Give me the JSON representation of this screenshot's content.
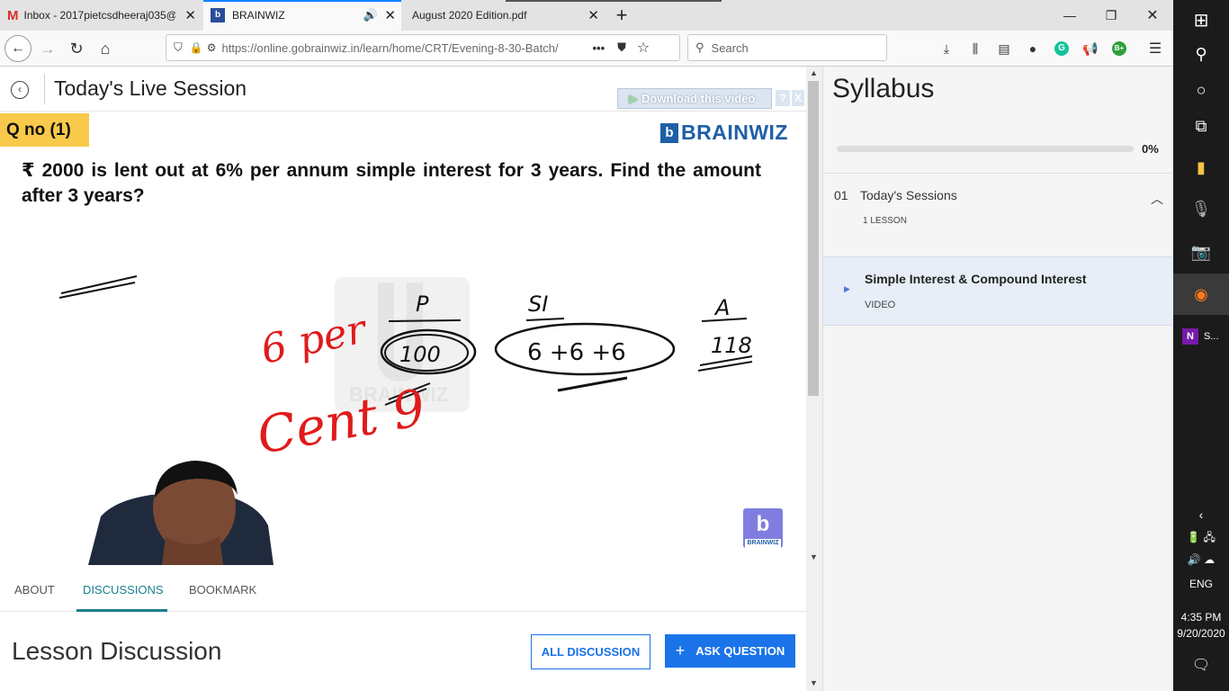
{
  "browser": {
    "tabs": [
      {
        "label": "Inbox - 2017pietcsdheeraj035@",
        "icon": "gmail-icon"
      },
      {
        "label": "BRAINWIZ",
        "icon": "brainwiz-icon",
        "audio": true
      },
      {
        "label": "August 2020 Edition.pdf",
        "icon": "pdf-icon"
      }
    ],
    "url": "https://online.gobrainwiz.in/learn/home/CRT/Evening-8-30-Batch/",
    "search_placeholder": "Search",
    "more_label": "•••",
    "bplus": "B+"
  },
  "session": {
    "back_icon": "back-circle-icon",
    "title": "Today's Live Session",
    "download_label": "Download this video",
    "help_label": "?",
    "close_label": "X"
  },
  "slide": {
    "qno": "Q no (1)",
    "logo_text": "BRAINWIZ",
    "question": "₹ 2000 is lent out at 6% per annum simple interest for 3 years. Find the amount after 3 years?",
    "watermark_text": "BRAINWIZ",
    "corner_logo_text": "BRAINWIZ",
    "handwriting": {
      "p": "P",
      "si": "SI",
      "a": "A",
      "p_val": "100",
      "si_val": "6 +6 +6",
      "a_val": "118",
      "red1": "6 per",
      "red2": "Cent 9"
    }
  },
  "tabs_bottom": {
    "items": [
      "ABOUT",
      "DISCUSSIONS",
      "BOOKMARK"
    ],
    "active": "DISCUSSIONS"
  },
  "discussion": {
    "heading": "Lesson Discussion",
    "all_label": "ALL DISCUSSION",
    "ask_label": "ASK QUESTION",
    "ask_icon": "+"
  },
  "syllabus": {
    "title": "Syllabus",
    "progress_value": 0,
    "progress_label": "0%",
    "section_number": "01",
    "section_title": "Today's Sessions",
    "section_count": "1 LESSON",
    "lesson_title": "Simple Interest & Compound Interest",
    "lesson_type": "VIDEO"
  },
  "taskbar": {
    "onenote_label": "S...",
    "lang": "ENG",
    "time": "4:35 PM",
    "date": "9/20/2020"
  },
  "colors": {
    "accent": "#1a73e8",
    "discussion_tab": "#1a7f8e",
    "qno_bg": "#f8c94a",
    "brainwiz_blue": "#1f5fa8",
    "ink_red": "#e01b1b",
    "taskbar": "#1b1b1b"
  }
}
